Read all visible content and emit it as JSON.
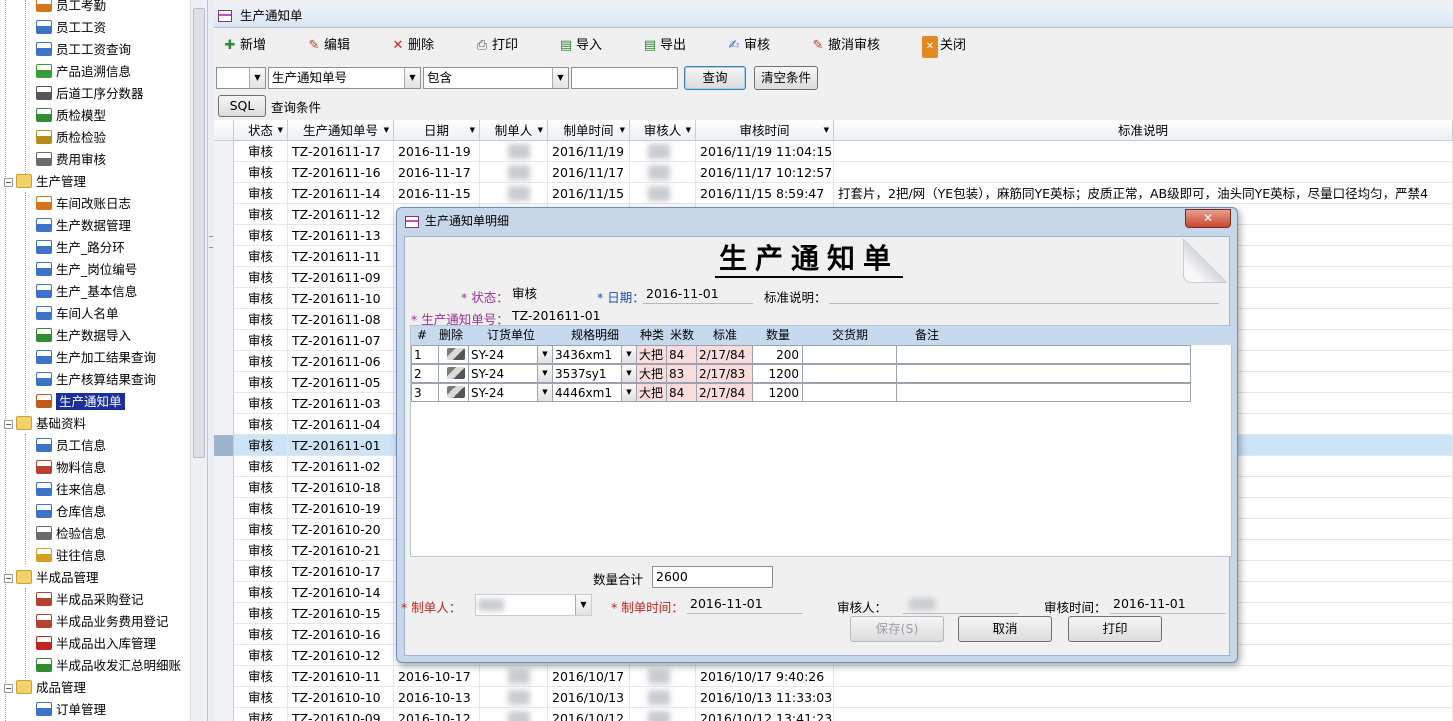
{
  "tree": {
    "items": [
      {
        "label": "员工考勤",
        "level": 2,
        "type": "leaf",
        "icon": "pen-icon",
        "color": "#d4751c"
      },
      {
        "label": "员工工资",
        "level": 2,
        "type": "leaf",
        "icon": "page-icon",
        "color": "#3d73c9"
      },
      {
        "label": "员工工资查询",
        "level": 2,
        "type": "leaf",
        "icon": "page-icon",
        "color": "#3d73c9"
      },
      {
        "label": "产品追溯信息",
        "level": 2,
        "type": "leaf",
        "icon": "list-icon",
        "color": "#3a9b3a"
      },
      {
        "label": "后道工序分数器",
        "level": 2,
        "type": "leaf",
        "icon": "grid-icon",
        "color": "#555555"
      },
      {
        "label": "质检模型",
        "level": 2,
        "type": "leaf",
        "icon": "chart-icon",
        "color": "#2f8c2f"
      },
      {
        "label": "质检检验",
        "level": 2,
        "type": "leaf",
        "icon": "table-icon",
        "color": "#b58b1c"
      },
      {
        "label": "费用审核",
        "level": 2,
        "type": "leaf",
        "icon": "user-icon",
        "color": "#6b6b6b"
      },
      {
        "label": "生产管理",
        "level": 1,
        "type": "group",
        "icon": "folder-icon"
      },
      {
        "label": "车间改账日志",
        "level": 2,
        "type": "leaf",
        "icon": "pen-icon",
        "color": "#d4751c"
      },
      {
        "label": "生产数据管理",
        "level": 2,
        "type": "leaf",
        "icon": "edit-icon",
        "color": "#3d73c9"
      },
      {
        "label": "生产_路分环",
        "level": 2,
        "type": "leaf",
        "icon": "edit-icon",
        "color": "#3d73c9"
      },
      {
        "label": "生产_岗位编号",
        "level": 2,
        "type": "leaf",
        "icon": "edit-icon",
        "color": "#3d73c9"
      },
      {
        "label": "生产_基本信息",
        "level": 2,
        "type": "leaf",
        "icon": "edit-icon",
        "color": "#3d73c9"
      },
      {
        "label": "车间人名单",
        "level": 2,
        "type": "leaf",
        "icon": "users-icon",
        "color": "#3d73c9"
      },
      {
        "label": "生产数据导入",
        "level": 2,
        "type": "leaf",
        "icon": "import-icon",
        "color": "#2f8c2f"
      },
      {
        "label": "生产加工结果查询",
        "level": 2,
        "type": "leaf",
        "icon": "page-icon",
        "color": "#3d73c9"
      },
      {
        "label": "生产核算结果查询",
        "level": 2,
        "type": "leaf",
        "icon": "page-icon",
        "color": "#3d73c9"
      },
      {
        "label": "生产通知单",
        "level": 2,
        "type": "leaf",
        "icon": "notice-icon",
        "color": "#c25a1c",
        "selected": true
      },
      {
        "label": "基础资料",
        "level": 1,
        "type": "group",
        "icon": "folder-icon"
      },
      {
        "label": "员工信息",
        "level": 2,
        "type": "leaf",
        "icon": "users-icon",
        "color": "#3d73c9"
      },
      {
        "label": "物料信息",
        "level": 2,
        "type": "leaf",
        "icon": "tag-icon",
        "color": "#b5412f"
      },
      {
        "label": "往来信息",
        "level": 2,
        "type": "leaf",
        "icon": "users-icon",
        "color": "#3d73c9"
      },
      {
        "label": "仓库信息",
        "level": 2,
        "type": "leaf",
        "icon": "house-icon",
        "color": "#3d73c9"
      },
      {
        "label": "检验信息",
        "level": 2,
        "type": "leaf",
        "icon": "user-icon",
        "color": "#6b6b6b"
      },
      {
        "label": "驻往信息",
        "level": 2,
        "type": "leaf",
        "icon": "user-icon",
        "color": "#d4a11c"
      },
      {
        "label": "半成品管理",
        "level": 1,
        "type": "group",
        "icon": "folder-icon"
      },
      {
        "label": "半成品采购登记",
        "level": 2,
        "type": "leaf",
        "icon": "tag-icon",
        "color": "#b5412f"
      },
      {
        "label": "半成品业务费用登记",
        "level": 2,
        "type": "leaf",
        "icon": "tag-icon",
        "color": "#b5412f"
      },
      {
        "label": "半成品出入库管理",
        "level": 2,
        "type": "leaf",
        "icon": "house-icon",
        "color": "#c2241f"
      },
      {
        "label": "半成品收发汇总明细账",
        "level": 2,
        "type": "leaf",
        "icon": "table-icon",
        "color": "#2f8c2f"
      },
      {
        "label": "成品管理",
        "level": 1,
        "type": "group",
        "icon": "folder-icon"
      },
      {
        "label": "订单管理",
        "level": 2,
        "type": "leaf",
        "icon": "edit-icon",
        "color": "#3d73c9"
      }
    ]
  },
  "window": {
    "title": "生产通知单"
  },
  "toolbar": {
    "new": "新增",
    "edit": "编辑",
    "delete": "删除",
    "print": "打印",
    "import": "导入",
    "export": "导出",
    "audit": "审核",
    "unaudit": "撤消审核",
    "close": "关闭"
  },
  "filter": {
    "field": "生产通知单号",
    "operator": "包含",
    "value": "",
    "query": "查询",
    "clear": "清空条件",
    "sql": "SQL",
    "condition_label": "查询条件"
  },
  "grid": {
    "columns": [
      "状态",
      "生产通知单号",
      "日期",
      "制单人",
      "制单时间",
      "审核人",
      "审核时间",
      "标准说明"
    ],
    "rows": [
      {
        "status": "审核",
        "no": "TZ-201611-17",
        "date": "2016-11-19",
        "maker": "",
        "make_time": "2016/11/19",
        "auditor": "",
        "audit_time": "2016/11/19 11:04:15",
        "note": ""
      },
      {
        "status": "审核",
        "no": "TZ-201611-16",
        "date": "2016-11-17",
        "maker": "",
        "make_time": "2016/11/17",
        "auditor": "",
        "audit_time": "2016/11/17 10:12:57",
        "note": ""
      },
      {
        "status": "审核",
        "no": "TZ-201611-14",
        "date": "2016-11-15",
        "maker": "",
        "make_time": "2016/11/15",
        "auditor": "",
        "audit_time": "2016/11/15 8:59:47",
        "note": "打套片，2把/网（YE包装），麻筋同YE英标；皮质正常，AB级即可，油头同YE英标，尽量口径均匀，严禁4"
      },
      {
        "status": "审核",
        "no": "TZ-201611-12",
        "date": "",
        "maker": "",
        "make_time": "",
        "auditor": "",
        "audit_time": "",
        "note": ""
      },
      {
        "status": "审核",
        "no": "TZ-201611-13",
        "date": "",
        "maker": "",
        "make_time": "",
        "auditor": "",
        "audit_time": "",
        "note": ""
      },
      {
        "status": "审核",
        "no": "TZ-201611-11",
        "date": "",
        "maker": "",
        "make_time": "",
        "auditor": "",
        "audit_time": "",
        "note": ""
      },
      {
        "status": "审核",
        "no": "TZ-201611-09",
        "date": "",
        "maker": "",
        "make_time": "",
        "auditor": "",
        "audit_time": "",
        "note": ""
      },
      {
        "status": "审核",
        "no": "TZ-201611-10",
        "date": "",
        "maker": "",
        "make_time": "",
        "auditor": "",
        "audit_time": "",
        "note": ""
      },
      {
        "status": "审核",
        "no": "TZ-201611-08",
        "date": "",
        "maker": "",
        "make_time": "",
        "auditor": "",
        "audit_time": "",
        "note": ""
      },
      {
        "status": "审核",
        "no": "TZ-201611-07",
        "date": "",
        "maker": "",
        "make_time": "",
        "auditor": "",
        "audit_time": "",
        "note": ""
      },
      {
        "status": "审核",
        "no": "TZ-201611-06",
        "date": "",
        "maker": "",
        "make_time": "",
        "auditor": "",
        "audit_time": "",
        "note": ""
      },
      {
        "status": "审核",
        "no": "TZ-201611-05",
        "date": "",
        "maker": "",
        "make_time": "",
        "auditor": "",
        "audit_time": "",
        "note": ""
      },
      {
        "status": "审核",
        "no": "TZ-201611-03",
        "date": "",
        "maker": "",
        "make_time": "",
        "auditor": "",
        "audit_time": "",
        "note": ""
      },
      {
        "status": "审核",
        "no": "TZ-201611-04",
        "date": "",
        "maker": "",
        "make_time": "",
        "auditor": "",
        "audit_time": "",
        "note": ""
      },
      {
        "status": "审核",
        "no": "TZ-201611-01",
        "date": "",
        "maker": "",
        "make_time": "",
        "auditor": "",
        "audit_time": "",
        "note": "",
        "selected": true
      },
      {
        "status": "审核",
        "no": "TZ-201611-02",
        "date": "",
        "maker": "",
        "make_time": "",
        "auditor": "",
        "audit_time": "",
        "note": ""
      },
      {
        "status": "审核",
        "no": "TZ-201610-18",
        "date": "",
        "maker": "",
        "make_time": "",
        "auditor": "",
        "audit_time": "",
        "note": ""
      },
      {
        "status": "审核",
        "no": "TZ-201610-19",
        "date": "",
        "maker": "",
        "make_time": "",
        "auditor": "",
        "audit_time": "",
        "note": ""
      },
      {
        "status": "审核",
        "no": "TZ-201610-20",
        "date": "",
        "maker": "",
        "make_time": "",
        "auditor": "",
        "audit_time": "",
        "note": ""
      },
      {
        "status": "审核",
        "no": "TZ-201610-21",
        "date": "",
        "maker": "",
        "make_time": "",
        "auditor": "",
        "audit_time": "",
        "note": ""
      },
      {
        "status": "审核",
        "no": "TZ-201610-17",
        "date": "",
        "maker": "",
        "make_time": "",
        "auditor": "",
        "audit_time": "",
        "note": ""
      },
      {
        "status": "审核",
        "no": "TZ-201610-14",
        "date": "",
        "maker": "",
        "make_time": "",
        "auditor": "",
        "audit_time": "",
        "note": ""
      },
      {
        "status": "审核",
        "no": "TZ-201610-15",
        "date": "",
        "maker": "",
        "make_time": "",
        "auditor": "",
        "audit_time": "",
        "note": ""
      },
      {
        "status": "审核",
        "no": "TZ-201610-16",
        "date": "",
        "maker": "",
        "make_time": "",
        "auditor": "",
        "audit_time": "",
        "note": ""
      },
      {
        "status": "审核",
        "no": "TZ-201610-12",
        "date": "",
        "maker": "",
        "make_time": "",
        "auditor": "",
        "audit_time": "",
        "note": ""
      },
      {
        "status": "审核",
        "no": "TZ-201610-11",
        "date": "2016-10-17",
        "maker": "",
        "make_time": "2016/10/17",
        "auditor": "",
        "audit_time": "2016/10/17 9:40:26",
        "note": ""
      },
      {
        "status": "审核",
        "no": "TZ-201610-10",
        "date": "2016-10-13",
        "maker": "",
        "make_time": "2016/10/13",
        "auditor": "",
        "audit_time": "2016/10/13 11:33:03",
        "note": ""
      },
      {
        "status": "审核",
        "no": "TZ-201610-09",
        "date": "2016-10-12",
        "maker": "",
        "make_time": "2016/10/12",
        "auditor": "",
        "audit_time": "2016/10/12 13:41:23",
        "note": ""
      }
    ]
  },
  "dialog": {
    "title": "生产通知单明细",
    "heading": "生产通知单",
    "close": "✕",
    "status_label": "* 状态：",
    "status_value": "审核",
    "date_label": "* 日期：",
    "date_value": "2016-11-01",
    "std_label": "标准说明：",
    "std_value": "",
    "no_label": "* 生产通知单号：",
    "no_value": "TZ-201611-01",
    "columns": [
      "#",
      "删除",
      "订货单位",
      "规格明细",
      "种类",
      "米数",
      "标准",
      "数量",
      "交货期",
      "备注"
    ],
    "rows": [
      {
        "idx": "1",
        "unit": "SY-24",
        "spec": "3436xm1",
        "kind": "大把",
        "meters": "84",
        "std": "2/17/84",
        "qty": "200",
        "due": "",
        "remark": ""
      },
      {
        "idx": "2",
        "unit": "SY-24",
        "spec": "3537sy1",
        "kind": "大把",
        "meters": "83",
        "std": "2/17/83",
        "qty": "1200",
        "due": "",
        "remark": ""
      },
      {
        "idx": "3",
        "unit": "SY-24",
        "spec": "4446xm1",
        "kind": "大把",
        "meters": "84",
        "std": "2/17/84",
        "qty": "1200",
        "due": "",
        "remark": ""
      }
    ],
    "total_label": "数量合计",
    "total_value": "2600",
    "maker_label": "* 制单人：",
    "maker_value": "",
    "make_time_label": "* 制单时间：",
    "make_time_value": "2016-11-01",
    "auditor_label": "审核人：",
    "auditor_value": "",
    "audit_time_label": "审核时间：",
    "audit_time_value": "2016-11-01",
    "save": "保存(S)",
    "cancel": "取消",
    "print": "打印"
  }
}
